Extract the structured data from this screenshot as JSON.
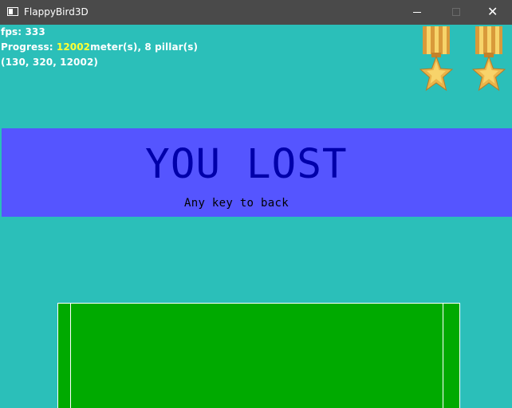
{
  "window": {
    "title": "FlappyBird3D",
    "close_glyph": "✕"
  },
  "hud": {
    "fps_label": "fps:",
    "fps_value": "333",
    "progress_label": "Progress:",
    "progress_value": "12002",
    "progress_suffix": "meter(s), 8 pillar(s)",
    "coords": "(130, 320, 12002)"
  },
  "medals": [
    {
      "icon": "gold-star-medal-icon"
    },
    {
      "icon": "gold-star-medal-icon"
    }
  ],
  "game_over": {
    "title": "YOU LOST",
    "subtitle": "Any key to back"
  },
  "colors": {
    "sky": "#2bbfb9",
    "banner": "#5555ff",
    "title_text": "#0000aa",
    "pillar": "#00aa00",
    "highlight": "#ffff33",
    "titlebar": "#4a4a4a"
  }
}
